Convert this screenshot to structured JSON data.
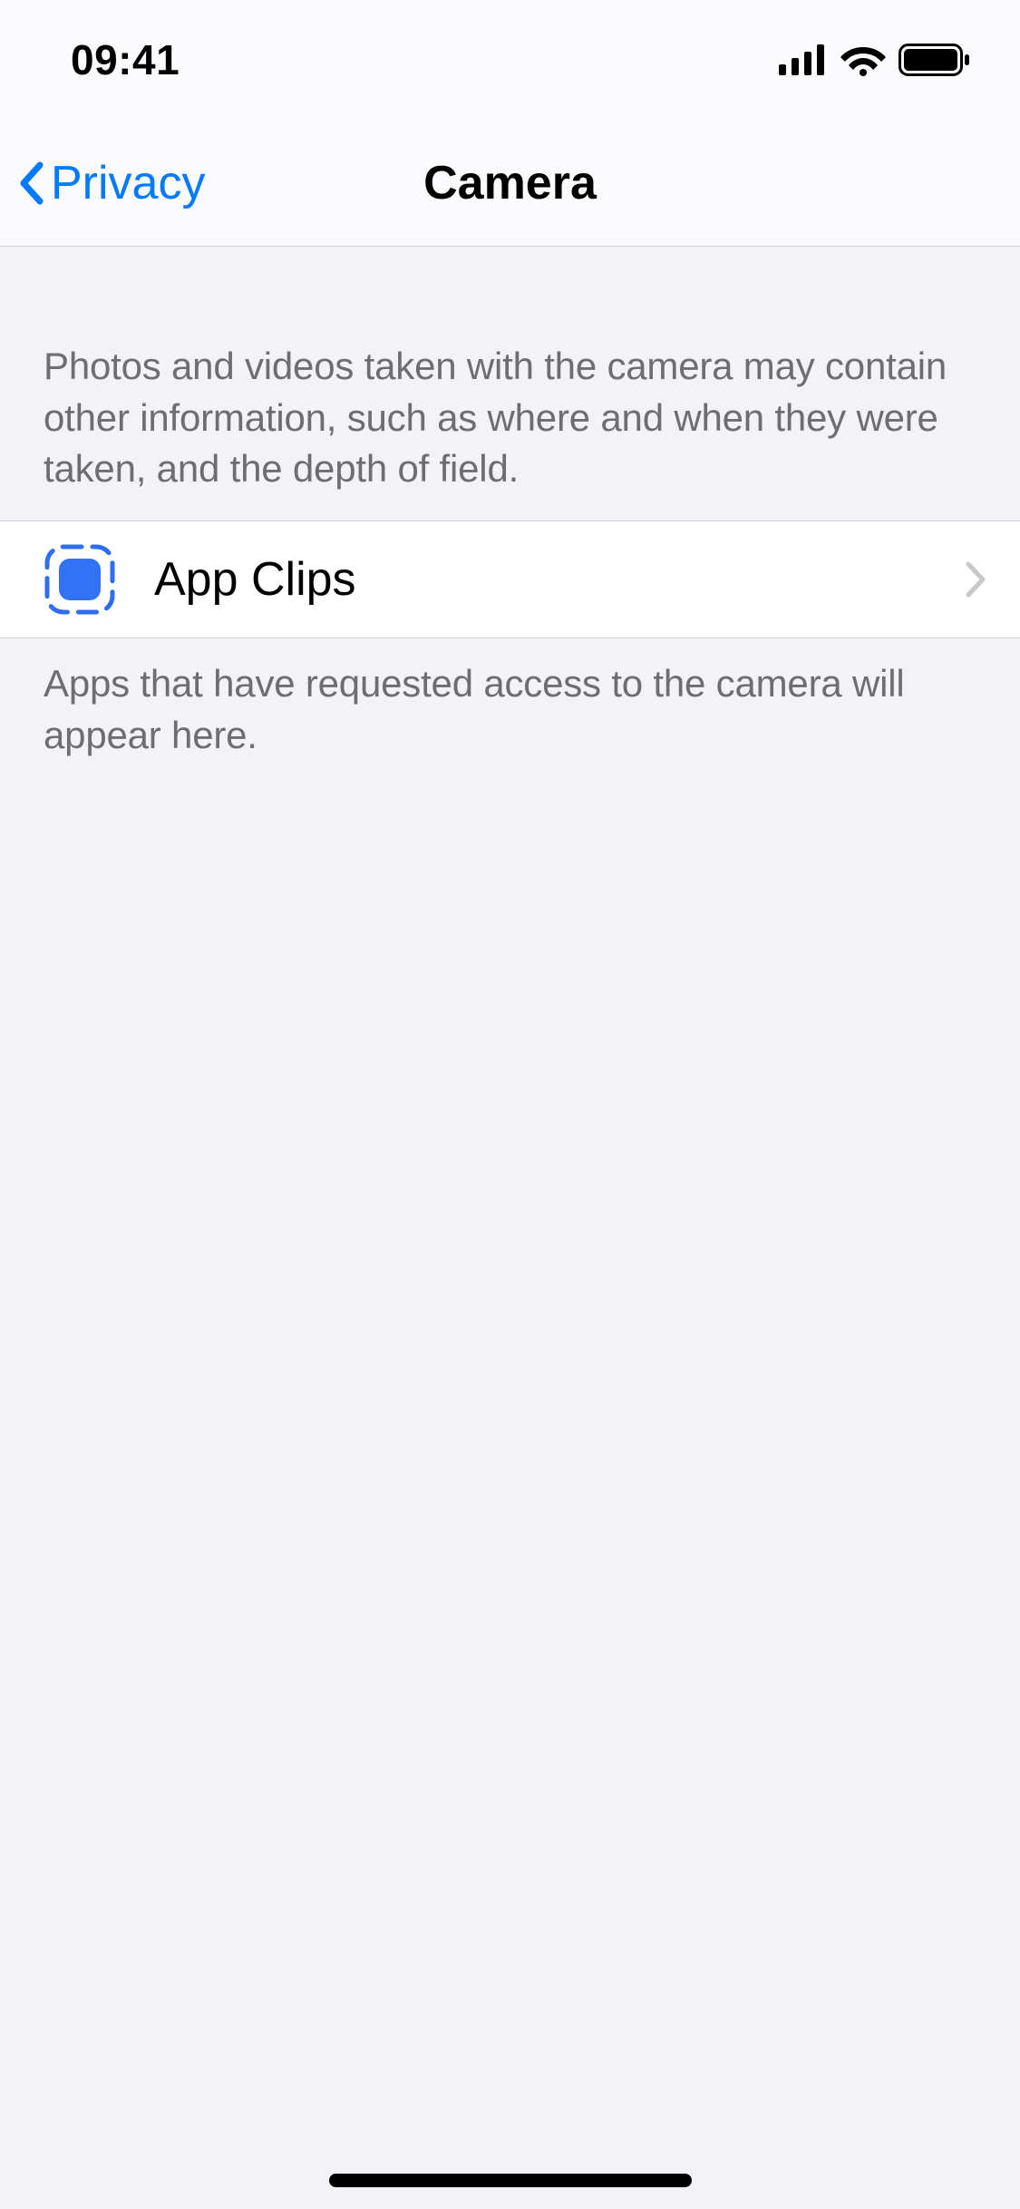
{
  "statusBar": {
    "time": "09:41"
  },
  "nav": {
    "backLabel": "Privacy",
    "title": "Camera"
  },
  "section": {
    "header": "Photos and videos taken with the camera may contain other information, such as where and when they were taken, and the depth of field.",
    "footer": "Apps that have requested access to the camera will appear here."
  },
  "rows": [
    {
      "label": "App Clips"
    }
  ],
  "colors": {
    "accent": "#007aff",
    "background": "#f2f2f7",
    "cellBackground": "#ffffff",
    "secondaryText": "#6d6d72"
  }
}
